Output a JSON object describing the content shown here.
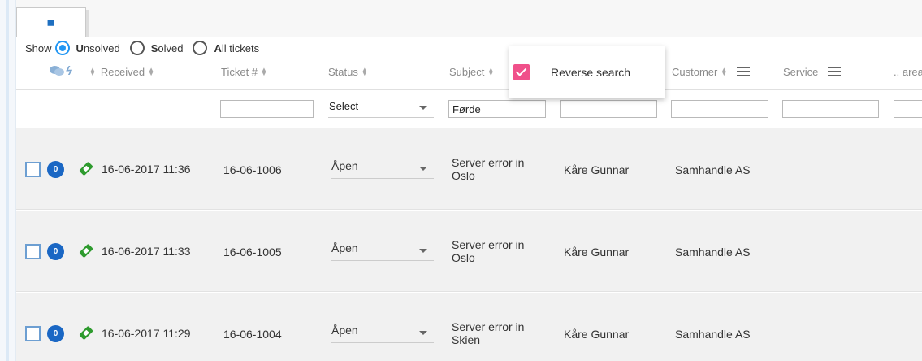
{
  "tab": {
    "icon": "ticket-icon",
    "icon_glyph": "✎"
  },
  "show": {
    "label": "Show",
    "options": [
      {
        "key": "U",
        "rest": "nsolved",
        "checked": true
      },
      {
        "key": "S",
        "rest": "olved",
        "checked": false
      },
      {
        "key": "A",
        "rest": "ll tickets",
        "checked": false
      }
    ]
  },
  "columns": {
    "received": "Received",
    "ticket": "Ticket #",
    "status": "Status",
    "subject": "Subject",
    "customer": "Customer",
    "service": "Service",
    "area": ".. area"
  },
  "filters": {
    "status_select": "Select",
    "subject_value": "Førde"
  },
  "popup": {
    "label": "Reverse search",
    "checked": true,
    "accent": "#f0508a"
  },
  "rows": [
    {
      "count": "0",
      "received": "16-06-2017 11:36",
      "ticket": "16-06-1006",
      "status": "Åpen",
      "subject": "Server error in Oslo",
      "requester": "Kåre Gunnar",
      "customer": "Samhandle AS"
    },
    {
      "count": "0",
      "received": "16-06-2017 11:33",
      "ticket": "16-06-1005",
      "status": "Åpen",
      "subject": "Server error in Oslo",
      "requester": "Kåre Gunnar",
      "customer": "Samhandle AS"
    },
    {
      "count": "0",
      "received": "16-06-2017 11:29",
      "ticket": "16-06-1004",
      "status": "Åpen",
      "subject": "Server error in Skien",
      "requester": "Kåre Gunnar",
      "customer": "Samhandle AS"
    }
  ],
  "colors": {
    "accent_blue": "#2196f3",
    "badge_blue": "#1a67c4",
    "ticket_green": "#2e9b2e"
  }
}
